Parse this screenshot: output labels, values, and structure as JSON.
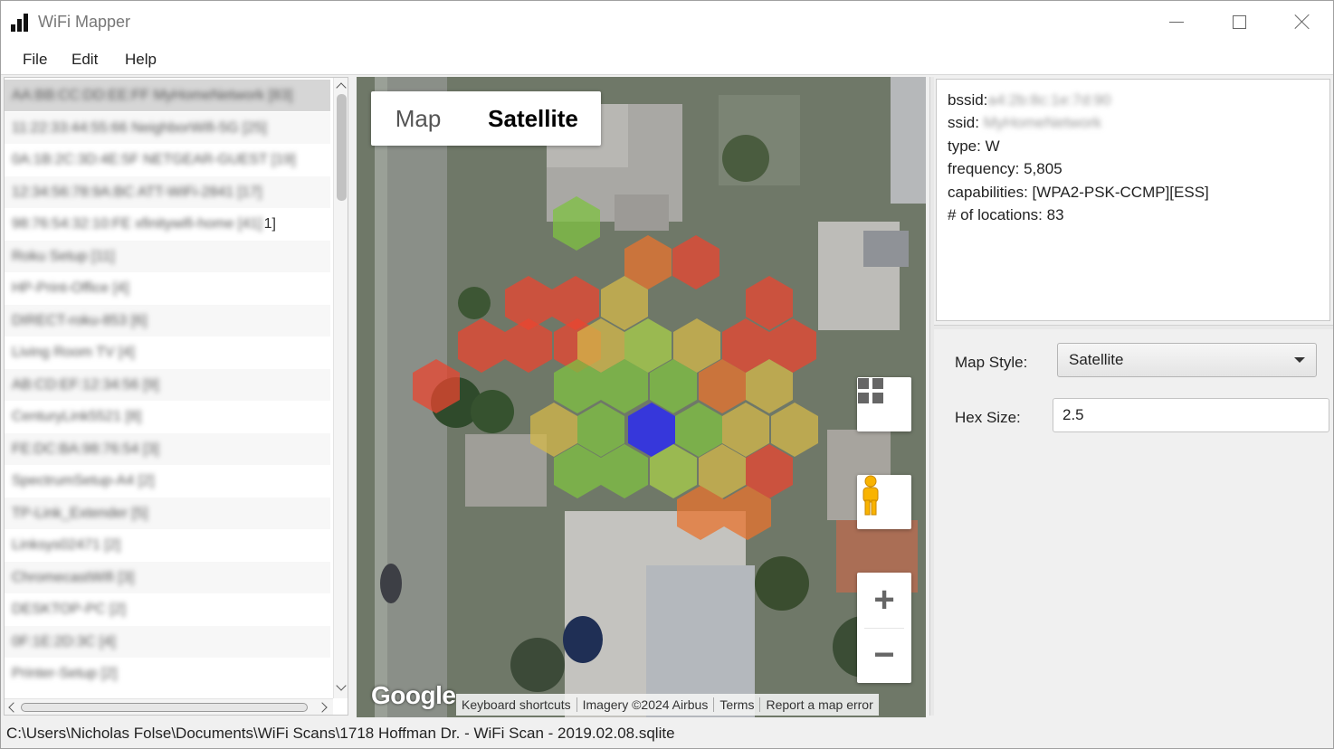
{
  "window": {
    "title": "WiFi Mapper",
    "app_icon": "signal-bars-icon"
  },
  "menu": {
    "items": [
      "File",
      "Edit",
      "Help"
    ]
  },
  "network_list": {
    "rows": [
      "AA:BB:CC:DD:EE:FF  MyHomeNetwork [83]",
      "11:22:33:44:55:66  NeighborWifi-5G [25]",
      "0A:1B:2C:3D:4E:5F  NETGEAR-GUEST [19]",
      "12:34:56:78:9A:BC  ATT-WiFi-2841 [17]",
      "98:76:54:32:10:FE  xfinitywifi-home [41]",
      "Roku Setup [11]",
      "HP-Print-Office [4]",
      "DIRECT-roku-853 [6]",
      "Living Room TV [4]",
      "AB:CD:EF:12:34:56 [9]",
      "CenturyLink5521 [8]",
      "FE:DC:BA:98:76:54 [3]",
      "SpectrumSetup-A4 [2]",
      "TP-Link_Extender [5]",
      "Linksys02471 [2]",
      "ChromecastWifi [3]",
      "DESKTOP-PC [2]",
      "0F:1E:2D:3C [4]",
      "Printer-Setup [2]"
    ],
    "row_19_suffix": "1]"
  },
  "map": {
    "type_control": {
      "map_label": "Map",
      "satellite_label": "Satellite",
      "selected": "Satellite"
    },
    "layers_icon": "layers-icon",
    "pegman_icon": "pegman-icon",
    "zoom_in_label": "+",
    "zoom_out_label": "−",
    "logo": "Google",
    "attribution": [
      "Keyboard shortcuts",
      "Imagery ©2024 Airbus",
      "Terms",
      "Report a map error"
    ],
    "colors": {
      "center": "#3030e8",
      "strong": "#7fc241",
      "good": "#a8cf4a",
      "medium": "#d4b84a",
      "weak": "#e8732e",
      "poor": "#ea4530"
    }
  },
  "details": {
    "bssid_label": "bssid:",
    "bssid_value": "a4:2b:8c:1e:7d:90",
    "ssid_label": "ssid:",
    "ssid_value": "MyHomeNetwork",
    "type": "type: W",
    "frequency": "frequency: 5,805",
    "capabilities": "capabilities: [WPA2-PSK-CCMP][ESS]",
    "locations": "# of locations: 83"
  },
  "settings": {
    "map_style_label": "Map Style:",
    "map_style_value": "Satellite",
    "hex_size_label": "Hex Size:",
    "hex_size_value": "2.5"
  },
  "status": {
    "path": "C:\\Users\\Nicholas Folse\\Documents\\WiFi Scans\\1718 Hoffman Dr. - WiFi Scan - 2019.02.08.sqlite"
  }
}
